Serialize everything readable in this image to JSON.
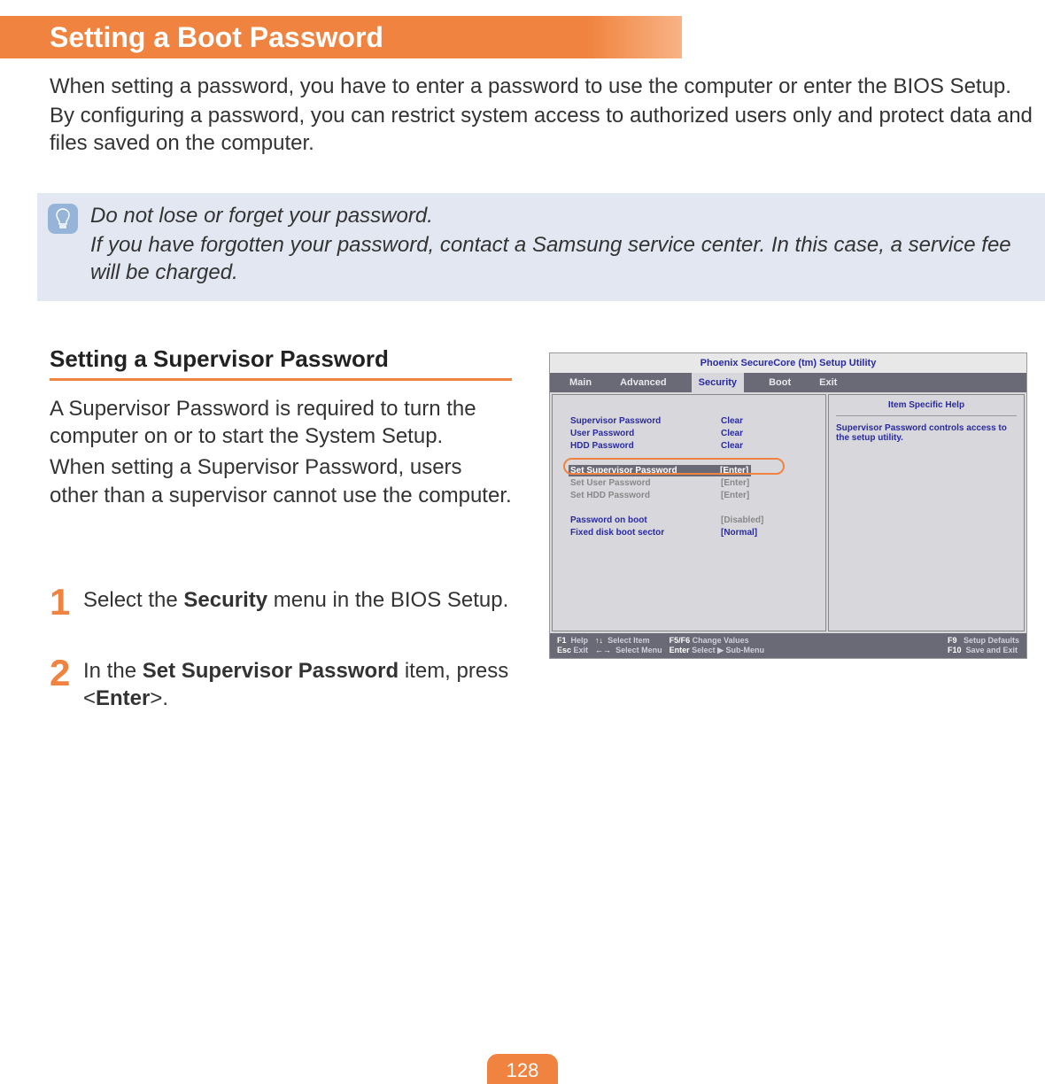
{
  "title": "Setting a Boot Password",
  "intro": {
    "p1": "When setting a password, you have to enter a password to use the computer or enter the BIOS Setup.",
    "p2": "By configuring a password, you can restrict system access to authorized users only and protect data and files saved on the computer."
  },
  "tip": {
    "line1": "Do not lose or forget your password.",
    "line2": "If you have forgotten your password, contact a Samsung service center. In this case, a service fee will be charged."
  },
  "section": {
    "heading": "Setting a Supervisor Password",
    "p1": "A Supervisor Password is required to turn the computer on or to start the System Setup.",
    "p2": "When setting a Supervisor Password, users other than a supervisor cannot use the computer."
  },
  "steps": {
    "s1": {
      "num": "1",
      "pre": "Select the ",
      "b": "Security",
      "post": " menu in the BIOS Setup."
    },
    "s2": {
      "num": "2",
      "pre": "In the ",
      "b1": "Set Supervisor Password",
      "mid": " item, press <",
      "b2": "Enter",
      "post": ">."
    }
  },
  "bios": {
    "title": "Phoenix SecureCore (tm) Setup Utility",
    "menu": [
      "Main",
      "Advanced",
      "Security",
      "Boot",
      "Exit"
    ],
    "active_menu": "Security",
    "rows": [
      {
        "label": "Supervisor Password",
        "value": "Clear"
      },
      {
        "label": "User Password",
        "value": "Clear"
      },
      {
        "label": "HDD Password",
        "value": "Clear"
      }
    ],
    "rows2": [
      {
        "label": "Set Supervisor Password",
        "value": "[Enter]",
        "selected": true
      },
      {
        "label": "Set User Password",
        "value": "[Enter]",
        "gray": true
      },
      {
        "label": "Set HDD Password",
        "value": "[Enter]",
        "gray": true
      }
    ],
    "rows3": [
      {
        "label": "Password on boot",
        "value": "[Disabled]",
        "gray": true
      },
      {
        "label": "Fixed disk boot sector",
        "value": "[Normal]"
      }
    ],
    "help": {
      "title": "Item Specific Help",
      "text": "Supervisor Password controls access to the setup utility."
    },
    "footer": {
      "f1": "F1",
      "help": "Help",
      "esc": "Esc",
      "exit": "Exit",
      "arrows1": "↑↓",
      "selitem": "Select Item",
      "arrows2": "←→",
      "selmenu": "Select Menu",
      "f5f6": "F5/F6",
      "change": "Change Values",
      "enter": "Enter",
      "selsub": "Select ▶ Sub-Menu",
      "f9": "F9",
      "defaults": "Setup Defaults",
      "f10": "F10",
      "save": "Save and Exit"
    }
  },
  "page_number": "128"
}
